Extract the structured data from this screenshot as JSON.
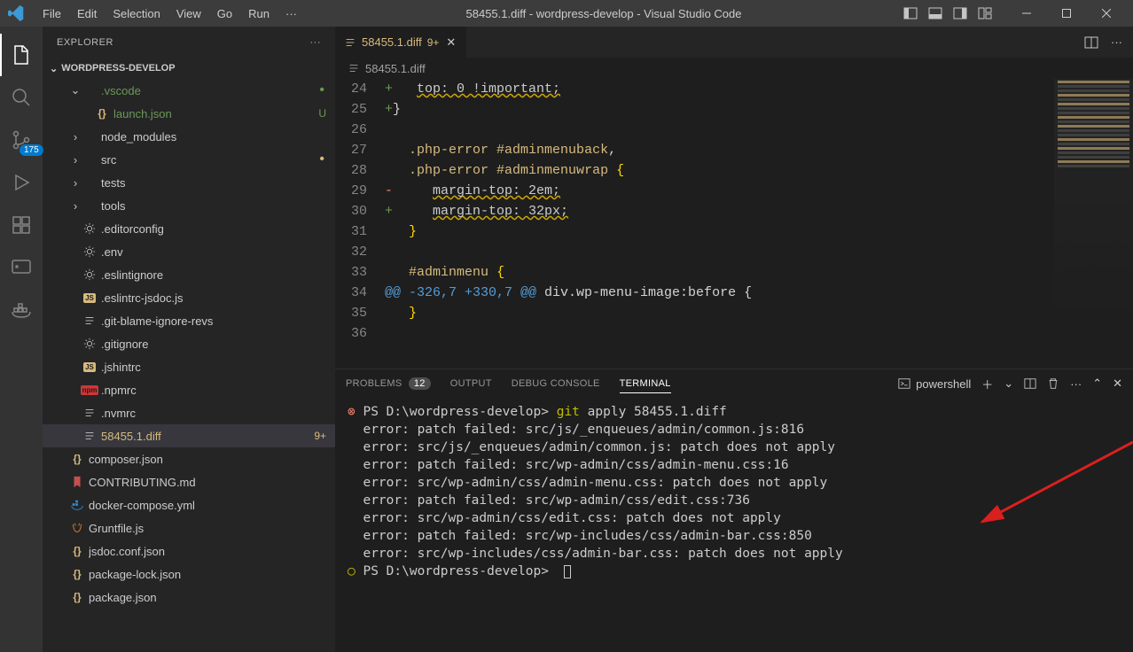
{
  "window": {
    "title": "58455.1.diff - wordpress-develop - Visual Studio Code",
    "menu": [
      "File",
      "Edit",
      "Selection",
      "View",
      "Go",
      "Run"
    ],
    "dots": "···"
  },
  "activity": {
    "scm_badge": "175"
  },
  "sidebar": {
    "header": "EXPLORER",
    "dots": "···",
    "project": "WORDPRESS-DEVELOP",
    "tree": [
      {
        "kind": "folder",
        "expanded": true,
        "name": ".vscode",
        "indent": 1,
        "color": "#6a9955",
        "dot": true
      },
      {
        "kind": "file",
        "name": "launch.json",
        "indent": 2,
        "icon": "{}",
        "iconColor": "#d7ba7d",
        "tag": "U",
        "tagColor": "#6a9955",
        "color": "#6a9955"
      },
      {
        "kind": "folder",
        "expanded": false,
        "name": "node_modules",
        "indent": 1
      },
      {
        "kind": "folder",
        "expanded": false,
        "name": "src",
        "indent": 1,
        "dot": true,
        "dotColor": "#d7ba7d"
      },
      {
        "kind": "folder",
        "expanded": false,
        "name": "tests",
        "indent": 1
      },
      {
        "kind": "folder",
        "expanded": false,
        "name": "tools",
        "indent": 1
      },
      {
        "kind": "file",
        "name": ".editorconfig",
        "indent": 1,
        "icon": "gear"
      },
      {
        "kind": "file",
        "name": ".env",
        "indent": 1,
        "icon": "gear"
      },
      {
        "kind": "file",
        "name": ".eslintignore",
        "indent": 1,
        "icon": "gear"
      },
      {
        "kind": "file",
        "name": ".eslintrc-jsdoc.js",
        "indent": 1,
        "icon": "JS",
        "iconColor": "#d7ba7d",
        "square": true
      },
      {
        "kind": "file",
        "name": ".git-blame-ignore-revs",
        "indent": 1,
        "icon": "lines"
      },
      {
        "kind": "file",
        "name": ".gitignore",
        "indent": 1,
        "icon": "gear"
      },
      {
        "kind": "file",
        "name": ".jshintrc",
        "indent": 1,
        "icon": "JS",
        "iconColor": "#d7ba7d",
        "square": true
      },
      {
        "kind": "file",
        "name": ".npmrc",
        "indent": 1,
        "icon": "npm",
        "iconColor": "#cb3837",
        "square": true
      },
      {
        "kind": "file",
        "name": ".nvmrc",
        "indent": 1,
        "icon": "lines"
      },
      {
        "kind": "file",
        "name": "58455.1.diff",
        "indent": 1,
        "icon": "lines",
        "color": "#d7ba7d",
        "tag": "9+",
        "tagColor": "#d7ba7d",
        "active": true
      },
      {
        "kind": "file",
        "name": "composer.json",
        "indent": 0,
        "icon": "{}",
        "iconColor": "#d7ba7d"
      },
      {
        "kind": "file",
        "name": "CONTRIBUTING.md",
        "indent": 0,
        "icon": "ribbon",
        "iconColor": "#c74e4e"
      },
      {
        "kind": "file",
        "name": "docker-compose.yml",
        "indent": 0,
        "icon": "whale",
        "iconColor": "#2496ed"
      },
      {
        "kind": "file",
        "name": "Gruntfile.js",
        "indent": 0,
        "icon": "grunt",
        "iconColor": "#e48632"
      },
      {
        "kind": "file",
        "name": "jsdoc.conf.json",
        "indent": 0,
        "icon": "{}",
        "iconColor": "#d7ba7d"
      },
      {
        "kind": "file",
        "name": "package-lock.json",
        "indent": 0,
        "icon": "{}",
        "iconColor": "#d7ba7d"
      },
      {
        "kind": "file",
        "name": "package.json",
        "indent": 0,
        "icon": "{}",
        "iconColor": "#d7ba7d"
      }
    ]
  },
  "editor": {
    "tab": {
      "filename": "58455.1.diff",
      "badge": "9+"
    },
    "breadcrumb": "58455.1.diff",
    "lines": [
      {
        "num": 24,
        "html": [
          "+",
          "   ",
          {
            "c": "squiggle",
            "t": "top: 0 !important;"
          }
        ]
      },
      {
        "num": 25,
        "html": [
          "+",
          "}"
        ]
      },
      {
        "num": 26,
        "html": [
          " "
        ]
      },
      {
        "num": 27,
        "html": [
          " ",
          "  ",
          {
            "c": "tok-sel",
            "t": ".php-error #adminmenuback"
          },
          {
            "c": "tok-default",
            "t": ","
          }
        ]
      },
      {
        "num": 28,
        "html": [
          " ",
          "  ",
          {
            "c": "tok-sel",
            "t": ".php-error #adminmenuwrap "
          },
          {
            "c": "tok-brace",
            "t": "{"
          }
        ]
      },
      {
        "num": 29,
        "html": [
          "-",
          "     ",
          {
            "c": "squiggle",
            "t": "margin-top: 2em;"
          }
        ]
      },
      {
        "num": 30,
        "html": [
          "+",
          "     ",
          {
            "c": "squiggle",
            "t": "margin-top: 32px;"
          }
        ]
      },
      {
        "num": 31,
        "html": [
          " ",
          "  ",
          {
            "c": "tok-brace",
            "t": "}"
          }
        ]
      },
      {
        "num": 32,
        "html": [
          " "
        ]
      },
      {
        "num": 33,
        "html": [
          " ",
          "  ",
          {
            "c": "tok-sel",
            "t": "#adminmenu "
          },
          {
            "c": "tok-brace",
            "t": "{"
          }
        ]
      },
      {
        "num": 34,
        "html": [
          {
            "c": "tok-hunk",
            "t": "@@ -326,7 +330,7 @@"
          },
          {
            "c": "tok-default",
            "t": " div.wp-menu-image:before {"
          }
        ]
      },
      {
        "num": 35,
        "html": [
          " ",
          "  ",
          {
            "c": "tok-brace",
            "t": "}"
          }
        ]
      },
      {
        "num": 36,
        "html": [
          " "
        ]
      }
    ]
  },
  "panel": {
    "tabs": {
      "problems": "PROBLEMS",
      "problems_count": "12",
      "output": "OUTPUT",
      "debug": "DEBUG CONSOLE",
      "terminal": "TERMINAL"
    },
    "shell": "powershell",
    "terminal": [
      {
        "mark": "err",
        "text": "PS D:\\wordpress-develop> ",
        "cmd": "git apply 58455.1.diff"
      },
      {
        "text": "error: patch failed: src/js/_enqueues/admin/common.js:816"
      },
      {
        "text": "error: src/js/_enqueues/admin/common.js: patch does not apply"
      },
      {
        "text": "error: patch failed: src/wp-admin/css/admin-menu.css:16"
      },
      {
        "text": "error: src/wp-admin/css/admin-menu.css: patch does not apply"
      },
      {
        "text": "error: patch failed: src/wp-admin/css/edit.css:736"
      },
      {
        "text": "error: src/wp-admin/css/edit.css: patch does not apply"
      },
      {
        "text": "error: patch failed: src/wp-includes/css/admin-bar.css:850"
      },
      {
        "text": "error: src/wp-includes/css/admin-bar.css: patch does not apply"
      },
      {
        "mark": "ok",
        "text": "PS D:\\wordpress-develop> ",
        "cursor": true
      }
    ]
  }
}
